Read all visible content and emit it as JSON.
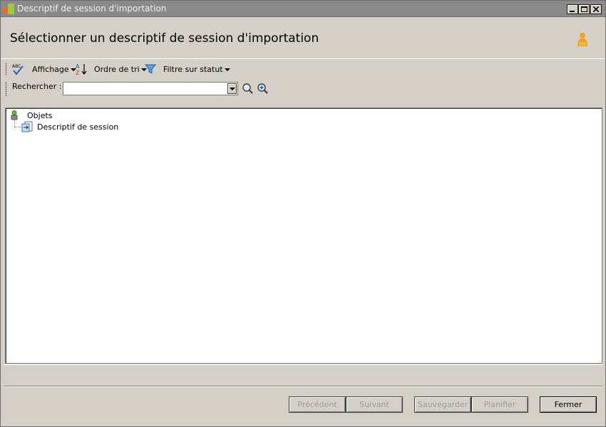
{
  "window": {
    "title": "Descriptif de session d'importation",
    "controls": [
      "minimize",
      "maximize",
      "close"
    ]
  },
  "header": {
    "title": "Sélectionner un descriptif de session d'importation",
    "icon": "user-icon"
  },
  "toolbar": {
    "spellcheck_icon": "spellcheck-icon",
    "view_label": "Affichage",
    "sort_icon": "sort-az-icon",
    "sort_label": "Ordre de tri",
    "filter_icon": "filter-icon",
    "filter_label": "Filtre sur statut"
  },
  "search": {
    "label": "Rechercher :",
    "value": "",
    "placeholder": "",
    "find_icon": "magnifier-icon",
    "advanced_icon": "zoom-in-icon"
  },
  "tree": {
    "root": {
      "label": "Objets",
      "icon": "objects-icon"
    },
    "children": [
      {
        "label": "Descriptif de session",
        "icon": "session-descriptor-icon"
      }
    ]
  },
  "buttons": {
    "previous": "Précédent",
    "next": "Suivant",
    "save": "Sauvegarder",
    "schedule": "Planifier",
    "close": "Fermer"
  },
  "colors": {
    "titlebar": "#8a8a8a",
    "window_bg": "#d4d0c8",
    "panel_bg": "#ffffff",
    "disabled_text": "#9a9a9a",
    "user_icon": "#f4a21b"
  }
}
